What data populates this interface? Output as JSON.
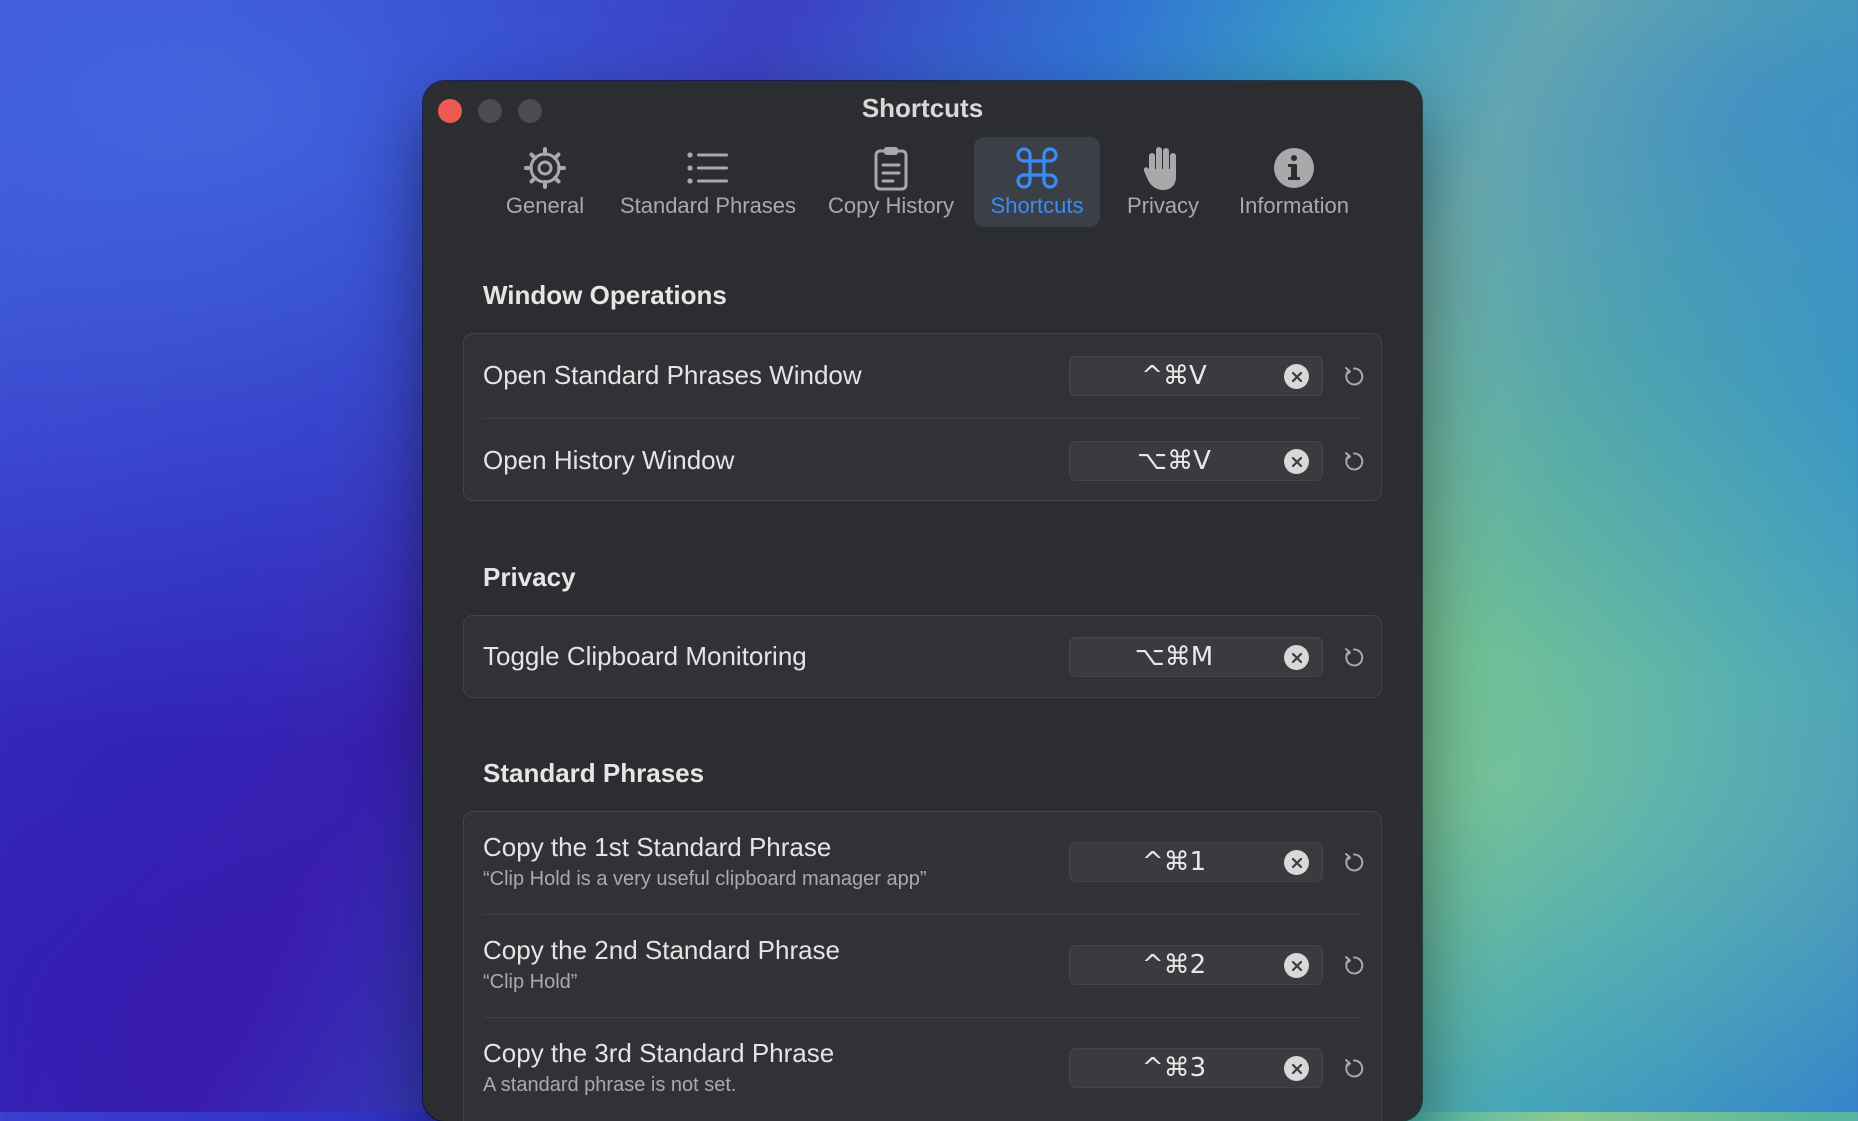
{
  "window": {
    "title": "Shortcuts"
  },
  "toolbar": {
    "tabs": [
      {
        "label": "General",
        "icon": "gear-icon"
      },
      {
        "label": "Standard Phrases",
        "icon": "list-icon"
      },
      {
        "label": "Copy History",
        "icon": "clipboard-icon"
      },
      {
        "label": "Shortcuts",
        "icon": "command-icon",
        "selected": true
      },
      {
        "label": "Privacy",
        "icon": "hand-icon"
      },
      {
        "label": "Information",
        "icon": "info-icon"
      }
    ]
  },
  "colors": {
    "accent": "#3b8cf6",
    "close": "#ee5a52",
    "window_bg": "#2c2d30"
  },
  "sections": [
    {
      "title": "Window Operations",
      "items": [
        {
          "name": "Open Standard Phrases Window",
          "shortcut": "^⌘V"
        },
        {
          "name": "Open History Window",
          "shortcut": "⌥⌘V"
        }
      ]
    },
    {
      "title": "Privacy",
      "items": [
        {
          "name": "Toggle Clipboard Monitoring",
          "shortcut": "⌥⌘M"
        }
      ]
    },
    {
      "title": "Standard Phrases",
      "items": [
        {
          "name": "Copy the 1st Standard Phrase",
          "subtitle": "“Clip Hold is a very useful clipboard manager app”",
          "shortcut": "^⌘1"
        },
        {
          "name": "Copy the 2nd Standard Phrase",
          "subtitle": "“Clip Hold”",
          "shortcut": "^⌘2"
        },
        {
          "name": "Copy the 3rd Standard Phrase",
          "subtitle": "A standard phrase is not set.",
          "shortcut": "^⌘3"
        }
      ]
    }
  ]
}
